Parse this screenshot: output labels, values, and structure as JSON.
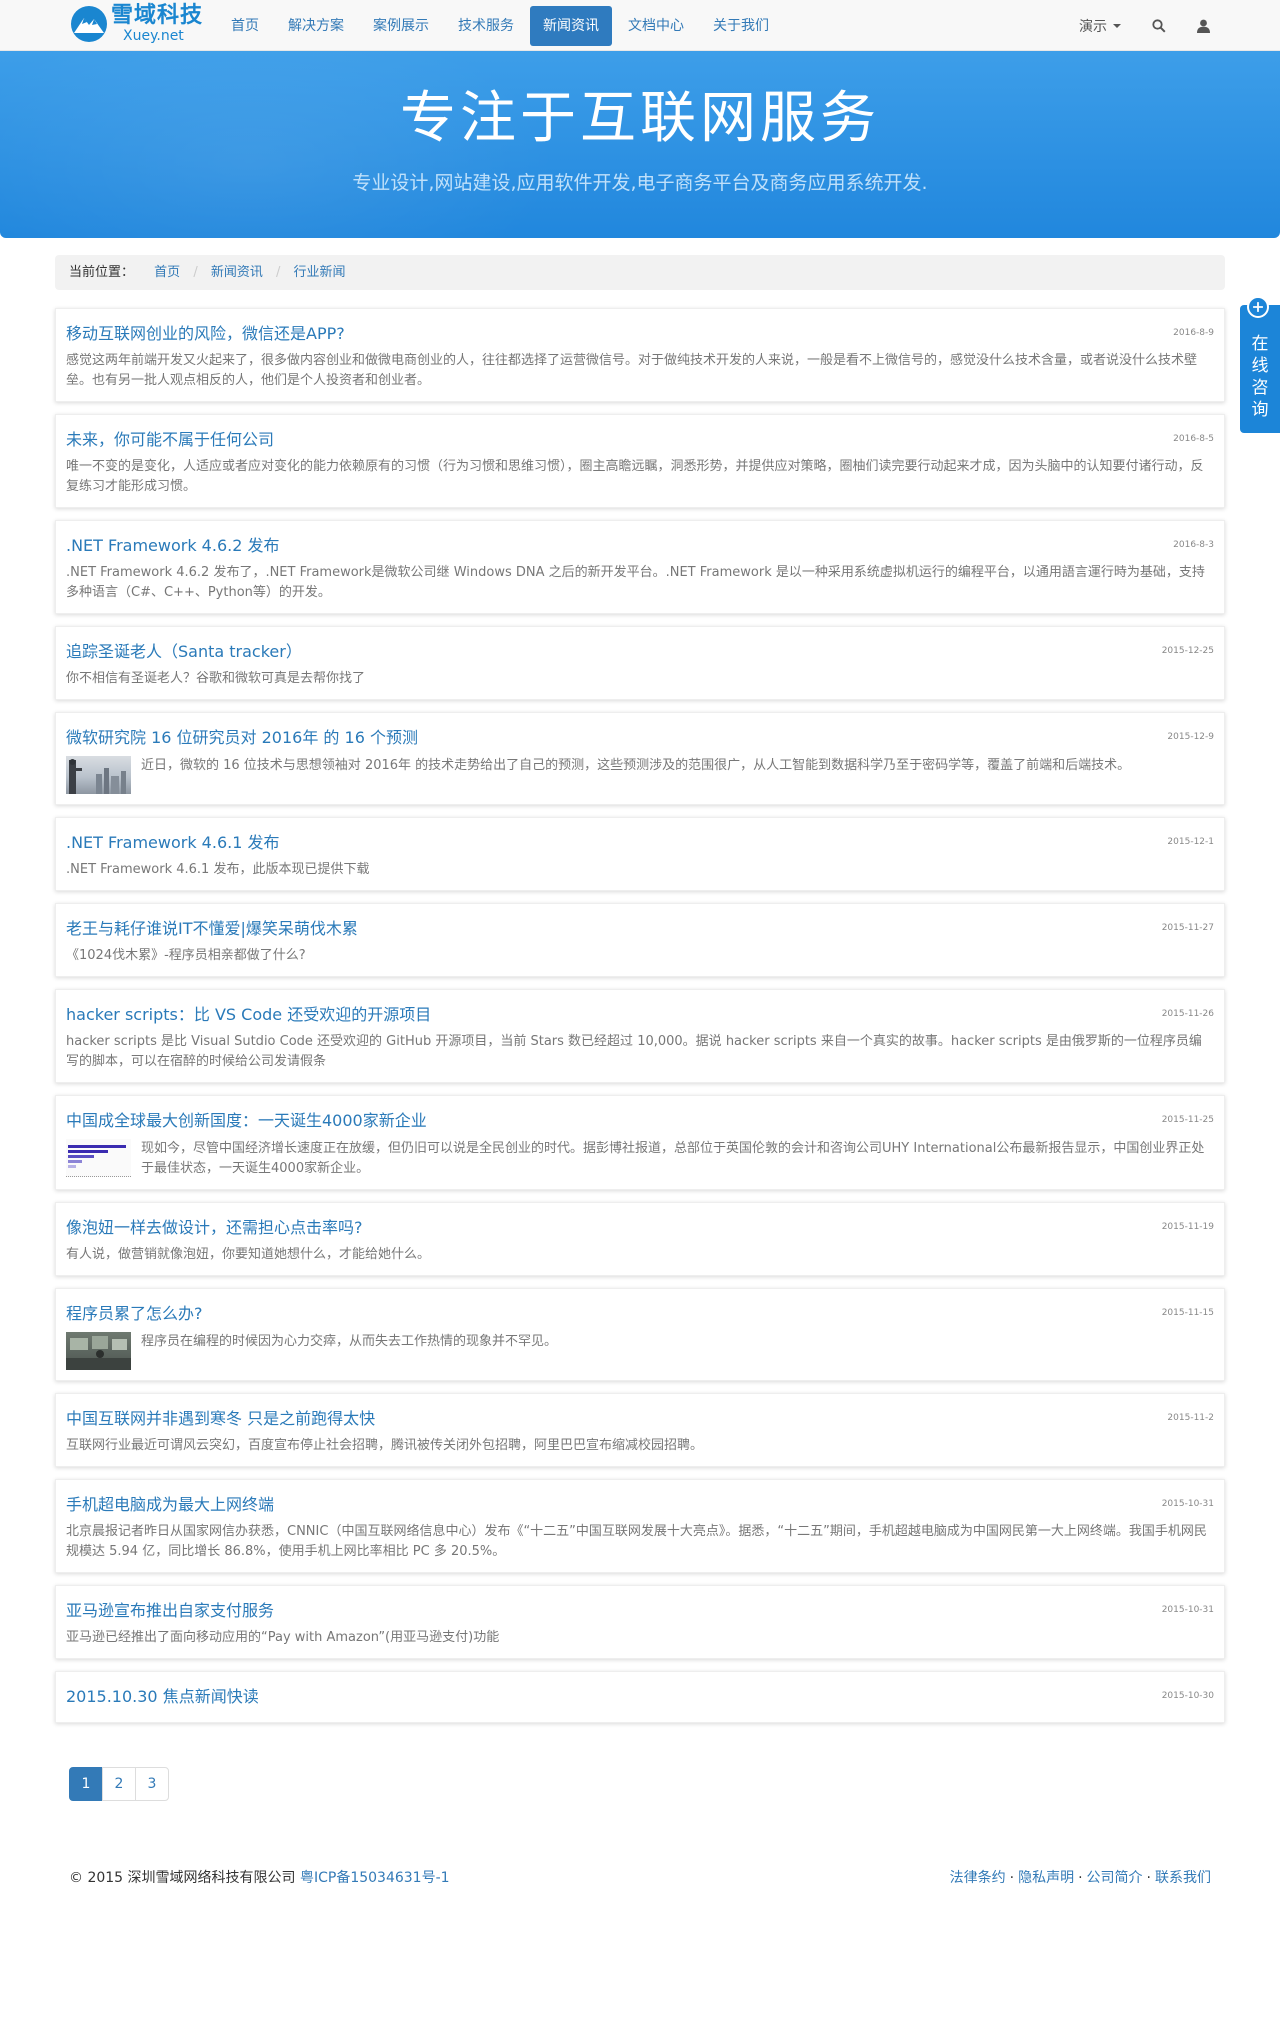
{
  "brand": {
    "name_cn": "雪域科技",
    "name_en": "Xuey.net",
    "colors": {
      "primary": "#2f7bbf",
      "hero": "#2187dd",
      "link": "#337ab7"
    }
  },
  "nav": {
    "items": [
      {
        "label": "首页",
        "active": false
      },
      {
        "label": "解决方案",
        "active": false
      },
      {
        "label": "案例展示",
        "active": false
      },
      {
        "label": "技术服务",
        "active": false
      },
      {
        "label": "新闻资讯",
        "active": true
      },
      {
        "label": "文档中心",
        "active": false
      },
      {
        "label": "关于我们",
        "active": false
      }
    ],
    "demo_label": "演示",
    "search_icon": "search-icon",
    "user_icon": "user-icon"
  },
  "hero": {
    "title": "专注于互联网服务",
    "subtitle": "专业设计,网站建设,应用软件开发,电子商务平台及商务应用系统开发."
  },
  "breadcrumb": {
    "label": "当前位置：",
    "items": [
      "首页",
      "新闻资讯",
      "行业新闻"
    ]
  },
  "articles": [
    {
      "title": "移动互联网创业的风险，微信还是APP?",
      "date": "2016-8-9",
      "desc": "感觉这两年前端开发又火起来了，很多做内容创业和做微电商创业的人，往往都选择了运营微信号。对于做纯技术开发的人来说，一般是看不上微信号的，感觉没什么技术含量，或者说没什么技术壁垒。也有另一批人观点相反的人，他们是个人投资者和创业者。"
    },
    {
      "title": "未来，你可能不属于任何公司",
      "date": "2016-8-5",
      "desc": "唯一不变的是变化，人适应或者应对变化的能力依赖原有的习惯（行为习惯和思维习惯），圈主高瞻远瞩，洞悉形势，并提供应对策略，圈柚们读完要行动起来才成，因为头脑中的认知要付诸行动，反复练习才能形成习惯。"
    },
    {
      "title": ".NET Framework 4.6.2 发布",
      "date": "2016-8-3",
      "desc": ".NET Framework 4.6.2 发布了，.NET Framework是微软公司继 Windows DNA 之后的新开发平台。.NET Framework 是以一种采用系统虚拟机运行的编程平台，以通用語言運行時为基础，支持多种语言（C#、C++、Python等）的开发。"
    },
    {
      "title": "追踪圣诞老人（Santa tracker）",
      "date": "2015-12-25",
      "desc": "你不相信有圣诞老人？谷歌和微软可真是去帮你找了"
    },
    {
      "title": "微软研究院 16 位研究员对 2016年 的 16 个预测",
      "date": "2015-12-9",
      "desc": "近日，微软的 16 位技术与思想领袖对 2016年 的技术走势给出了自己的预测，这些预测涉及的范围很广，从人工智能到数据科学乃至于密码学等，覆盖了前端和后端技术。",
      "thumb": "city"
    },
    {
      "title": ".NET Framework 4.6.1 发布",
      "date": "2015-12-1",
      "desc": ".NET Framework 4.6.1 发布，此版本现已提供下载"
    },
    {
      "title": "老王与耗仔谁说IT不懂爱|爆笑呆萌伐木累",
      "date": "2015-11-27",
      "desc": "《1024伐木累》-程序员相亲都做了什么?"
    },
    {
      "title": "hacker scripts：比 VS Code 还受欢迎的开源项目",
      "date": "2015-11-26",
      "desc": "hacker scripts 是比 Visual Sutdio Code 还受欢迎的 GitHub 开源项目，当前 Stars 数已经超过 10,000。据说 hacker scripts 来自一个真实的故事。hacker scripts 是由俄罗斯的一位程序员编写的脚本，可以在宿醉的时候给公司发请假条"
    },
    {
      "title": "中国成全球最大创新国度：一天诞生4000家新企业",
      "date": "2015-11-25",
      "desc": "现如今，尽管中国经济增长速度正在放缓，但仍旧可以说是全民创业的时代。据彭博社报道，总部位于英国伦敦的会计和咨询公司UHY International公布最新报告显示，中国创业界正处于最佳状态，一天诞生4000家新企业。",
      "thumb": "chart"
    },
    {
      "title": "像泡妞一样去做设计，还需担心点击率吗?",
      "date": "2015-11-19",
      "desc": "有人说，做营销就像泡妞，你要知道她想什么，才能给她什么。"
    },
    {
      "title": "程序员累了怎么办?",
      "date": "2015-11-15",
      "desc": "程序员在编程的时候因为心力交瘁，从而失去工作热情的现象并不罕见。",
      "thumb": "office"
    },
    {
      "title": "中国互联网并非遇到寒冬 只是之前跑得太快",
      "date": "2015-11-2",
      "desc": "互联网行业最近可谓风云突幻，百度宣布停止社会招聘，腾讯被传关闭外包招聘，阿里巴巴宣布缩减校园招聘。"
    },
    {
      "title": "手机超电脑成为最大上网终端",
      "date": "2015-10-31",
      "desc": "北京晨报记者昨日从国家网信办获悉，CNNIC（中国互联网络信息中心）发布《“十二五”中国互联网发展十大亮点》。据悉，“十二五”期间，手机超越电脑成为中国网民第一大上网终端。我国手机网民规模达 5.94 亿，同比增长 86.8%，使用手机上网比率相比 PC 多 20.5%。"
    },
    {
      "title": "亚马逊宣布推出自家支付服务",
      "date": "2015-10-31",
      "desc": "亚马逊已经推出了面向移动应用的“Pay with Amazon”(用亚马逊支付)功能"
    },
    {
      "title": "2015.10.30 焦点新闻快读",
      "date": "2015-10-30",
      "desc": ""
    }
  ],
  "pagination": {
    "pages": [
      "1",
      "2",
      "3"
    ],
    "current": "1"
  },
  "footer": {
    "copyright": "© 2015 深圳雪域网络科技有限公司",
    "icp": "粤ICP备15034631号-1",
    "links": [
      "法律条约",
      "隐私声明",
      "公司简介",
      "联系我们"
    ]
  },
  "consult": {
    "label": "在线咨询",
    "chars": [
      "在",
      "线",
      "咨",
      "询"
    ]
  }
}
